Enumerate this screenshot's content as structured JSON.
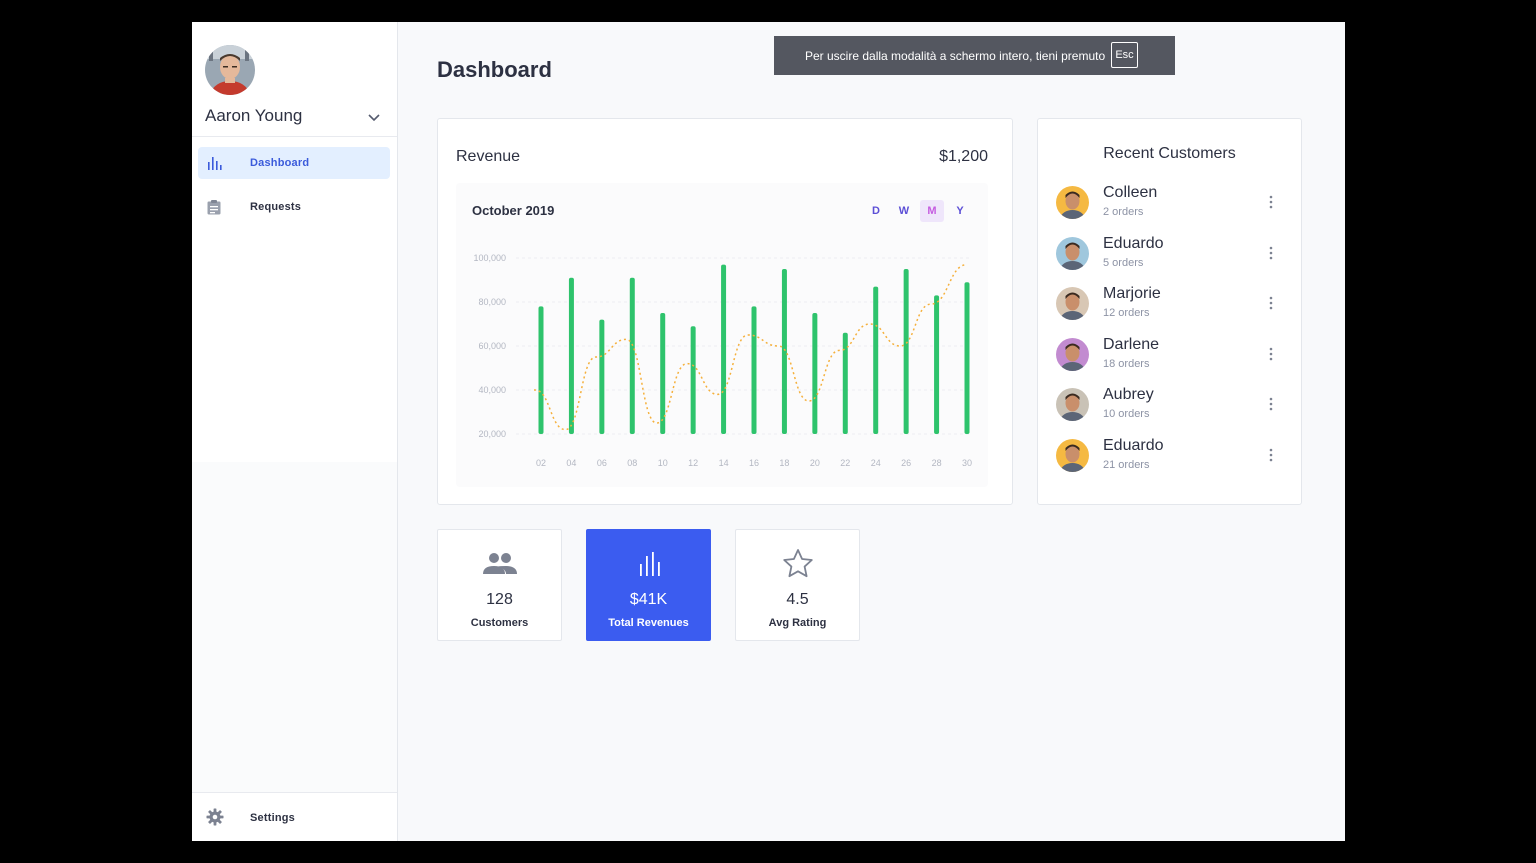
{
  "user": {
    "name": "Aaron Young",
    "avatar": "user-avatar",
    "menu_icon": "chevron-down-icon"
  },
  "sidebar": {
    "items": [
      {
        "label": "Dashboard",
        "icon": "bar-chart-icon",
        "active": true
      },
      {
        "label": "Requests",
        "icon": "clipboard-icon",
        "active": false
      }
    ],
    "settings": {
      "label": "Settings",
      "icon": "gear-icon"
    }
  },
  "page": {
    "title": "Dashboard"
  },
  "toast": {
    "message": "Per uscire dalla modalità a schermo intero, tieni premuto",
    "key": "Esc"
  },
  "revenue": {
    "title": "Revenue",
    "amount": "$1,200",
    "period": "October 2019",
    "filters": [
      "D",
      "W",
      "M",
      "Y"
    ],
    "active_filter": "M"
  },
  "chart_data": {
    "type": "bar",
    "x": [
      "02",
      "04",
      "06",
      "08",
      "10",
      "12",
      "14",
      "16",
      "18",
      "20",
      "22",
      "24",
      "26",
      "28",
      "30"
    ],
    "values": [
      78000,
      91000,
      72000,
      91000,
      75000,
      69000,
      97000,
      78000,
      95000,
      75000,
      66000,
      87000,
      95000,
      83000,
      89000
    ],
    "series": [
      {
        "type": "line",
        "style": "dotted",
        "values": [
          40000,
          22000,
          55000,
          63000,
          25000,
          52000,
          38000,
          65000,
          60000,
          35000,
          58000,
          70000,
          60000,
          79000,
          97000
        ]
      }
    ],
    "yticks": [
      "20,000",
      "40,000",
      "60,000",
      "80,000",
      "100,000"
    ],
    "ylim": [
      20000,
      100000
    ],
    "colors": {
      "bar": "#2ec36c",
      "line": "#f5b03c"
    }
  },
  "recent_customers": {
    "title": "Recent Customers",
    "list": [
      {
        "name": "Colleen",
        "orders": "2 orders",
        "avatar_bg": "#f5b942"
      },
      {
        "name": "Eduardo",
        "orders": "5 orders",
        "avatar_bg": "#9fc7dd"
      },
      {
        "name": "Marjorie",
        "orders": "12 orders",
        "avatar_bg": "#d8c7b4"
      },
      {
        "name": "Darlene",
        "orders": "18 orders",
        "avatar_bg": "#c28bd0"
      },
      {
        "name": "Aubrey",
        "orders": "10 orders",
        "avatar_bg": "#c9c2b6"
      },
      {
        "name": "Eduardo",
        "orders": "21 orders",
        "avatar_bg": "#f5b942"
      }
    ]
  },
  "stats": [
    {
      "value": "128",
      "label": "Customers",
      "icon": "users-icon"
    },
    {
      "value": "$41K",
      "label": "Total Revenues",
      "icon": "bar-chart-icon"
    },
    {
      "value": "4.5",
      "label": "Avg Rating",
      "icon": "star-icon"
    }
  ],
  "colors": {
    "accent": "#3b5cf0",
    "active_nav_bg": "#e3efff"
  }
}
